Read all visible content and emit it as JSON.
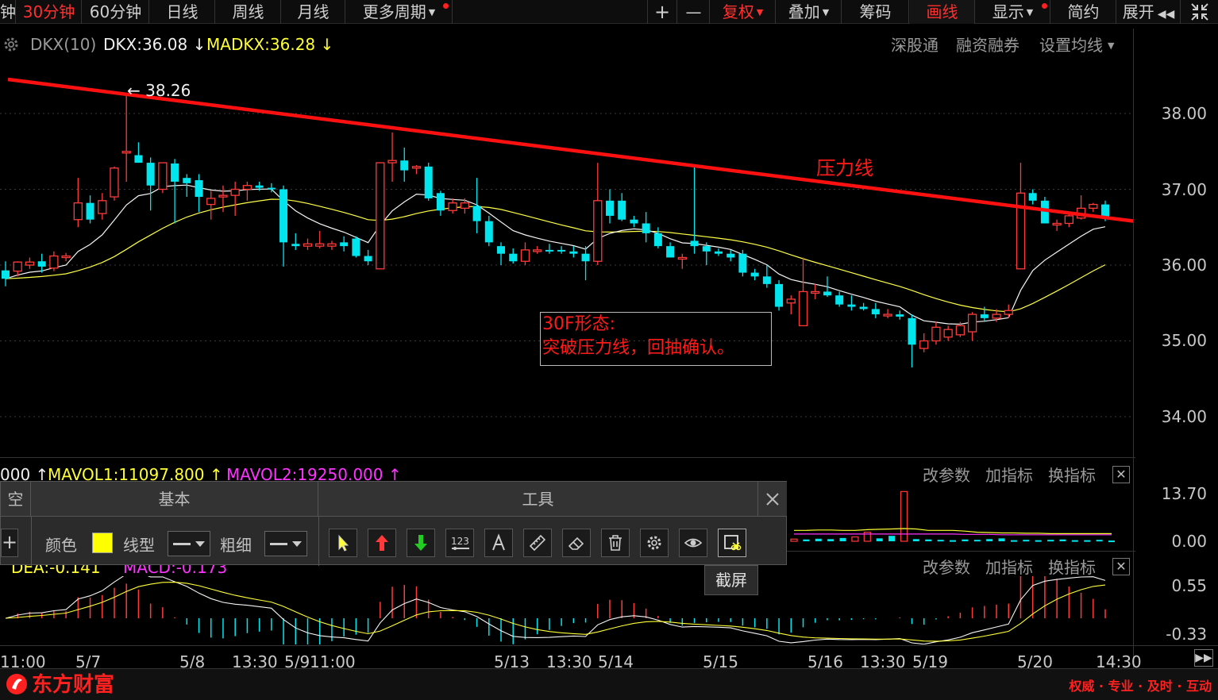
{
  "toolbar": {
    "tabs": [
      {
        "label": "钟",
        "active": false
      },
      {
        "label": "30分钟",
        "active": true
      },
      {
        "label": "60分钟",
        "active": false
      },
      {
        "label": "日线",
        "active": false
      },
      {
        "label": "周线",
        "active": false
      },
      {
        "label": "月线",
        "active": false
      },
      {
        "label": "更多周期",
        "active": false
      }
    ],
    "right": {
      "zoom_in": "+",
      "zoom_out": "—",
      "fuquan": "复权",
      "diejia": "叠加",
      "chouma": "筹码",
      "huaxian": "画线",
      "xianshi": "显示",
      "jianyue": "简约",
      "zhankai": "展开"
    }
  },
  "main_indicator": {
    "name": "DKX(10)",
    "dkx": "DKX:36.08",
    "madkx": "MADKX:36.28",
    "links": [
      "深股通",
      "融资融券",
      "设置均线"
    ]
  },
  "price_axis": [
    "38.00",
    "37.00",
    "36.00",
    "35.00",
    "34.00"
  ],
  "high_marker": "38.26",
  "pressure_line_label": "压力线",
  "annotation": {
    "line1": "30F形态:",
    "line2": "突破压力线，回抽确认。"
  },
  "volume_panel": {
    "vol_partial": "000",
    "mavol1": "MAVOL1:11097.800",
    "mavol2": "MAVOL2:19250.000",
    "links": [
      "改参数",
      "加指标",
      "换指标"
    ],
    "axis": [
      "13.70",
      "0.00"
    ]
  },
  "macd_panel": {
    "dea": "DEA:-0.141",
    "macd": "MACD:-0.173",
    "links": [
      "改参数",
      "加指标",
      "换指标"
    ],
    "axis": [
      "0.55",
      "-0.33"
    ]
  },
  "x_axis": [
    "11:00",
    "5/7",
    "5/8",
    "13:30",
    "5/9",
    "11:00",
    "5/13",
    "13:30",
    "5/14",
    "5/15",
    "5/16",
    "13:30",
    "5/19",
    "5/20",
    "14:30"
  ],
  "tool_panel": {
    "section_left_partial": "空",
    "section_basic": "基本",
    "section_tools": "工具",
    "color_label": "颜色",
    "line_type_label": "线型",
    "thickness_label": "粗细",
    "color_value": "#ffff00",
    "tooltip": "截屏"
  },
  "footer": {
    "logo": "东方财富",
    "slogan": "权威 · 专业 · 及时 · 互动"
  },
  "colors": {
    "up": "#ff3a3a",
    "down": "#00e5ee",
    "pressure_line": "#ff1010",
    "dkx_line": "#f5f5f5",
    "madkx_line": "#ffff44"
  },
  "chart_data": {
    "type": "candlestick",
    "period": "30分钟",
    "ylim": [
      33.5,
      38.9
    ],
    "candles": [
      {
        "o": 35.93,
        "h": 36.05,
        "l": 35.72,
        "c": 35.82
      },
      {
        "o": 35.92,
        "h": 36.05,
        "l": 35.85,
        "c": 36.04
      },
      {
        "o": 36.0,
        "h": 36.1,
        "l": 35.95,
        "c": 36.04
      },
      {
        "o": 36.05,
        "h": 36.15,
        "l": 35.9,
        "c": 35.98
      },
      {
        "o": 35.96,
        "h": 36.18,
        "l": 35.92,
        "c": 36.12
      },
      {
        "o": 36.1,
        "h": 36.16,
        "l": 36.05,
        "c": 36.12
      },
      {
        "o": 36.6,
        "h": 37.15,
        "l": 36.5,
        "c": 36.82
      },
      {
        "o": 36.82,
        "h": 36.92,
        "l": 36.55,
        "c": 36.6
      },
      {
        "o": 36.68,
        "h": 36.95,
        "l": 36.6,
        "c": 36.85
      },
      {
        "o": 36.9,
        "h": 37.3,
        "l": 36.85,
        "c": 37.28
      },
      {
        "o": 37.5,
        "h": 38.26,
        "l": 37.1,
        "c": 37.5
      },
      {
        "o": 37.45,
        "h": 37.62,
        "l": 37.35,
        "c": 37.35
      },
      {
        "o": 37.35,
        "h": 37.42,
        "l": 36.72,
        "c": 37.05
      },
      {
        "o": 37.0,
        "h": 37.35,
        "l": 36.95,
        "c": 37.35
      },
      {
        "o": 37.34,
        "h": 37.4,
        "l": 36.55,
        "c": 37.1
      },
      {
        "o": 37.15,
        "h": 37.2,
        "l": 36.9,
        "c": 37.08
      },
      {
        "o": 37.12,
        "h": 37.2,
        "l": 36.7,
        "c": 36.9
      },
      {
        "o": 36.8,
        "h": 36.98,
        "l": 36.6,
        "c": 36.88
      },
      {
        "o": 36.9,
        "h": 37.05,
        "l": 36.7,
        "c": 36.92
      },
      {
        "o": 36.92,
        "h": 37.1,
        "l": 36.65,
        "c": 37.0
      },
      {
        "o": 37.0,
        "h": 37.1,
        "l": 36.85,
        "c": 37.05
      },
      {
        "o": 37.05,
        "h": 37.1,
        "l": 36.98,
        "c": 37.02
      },
      {
        "o": 37.02,
        "h": 37.08,
        "l": 36.96,
        "c": 37.01
      },
      {
        "o": 37.0,
        "h": 37.05,
        "l": 35.98,
        "c": 36.3
      },
      {
        "o": 36.28,
        "h": 36.42,
        "l": 36.2,
        "c": 36.25
      },
      {
        "o": 36.25,
        "h": 36.35,
        "l": 36.2,
        "c": 36.28
      },
      {
        "o": 36.25,
        "h": 36.45,
        "l": 36.22,
        "c": 36.28
      },
      {
        "o": 36.25,
        "h": 36.32,
        "l": 36.2,
        "c": 36.28
      },
      {
        "o": 36.3,
        "h": 36.38,
        "l": 36.18,
        "c": 36.25
      },
      {
        "o": 36.35,
        "h": 36.38,
        "l": 36.1,
        "c": 36.12
      },
      {
        "o": 36.12,
        "h": 36.2,
        "l": 36.0,
        "c": 36.05
      },
      {
        "o": 35.95,
        "h": 37.35,
        "l": 35.95,
        "c": 37.35
      },
      {
        "o": 37.35,
        "h": 37.75,
        "l": 37.1,
        "c": 37.38
      },
      {
        "o": 37.38,
        "h": 37.55,
        "l": 37.1,
        "c": 37.25
      },
      {
        "o": 37.28,
        "h": 37.32,
        "l": 37.2,
        "c": 37.3
      },
      {
        "o": 37.3,
        "h": 37.35,
        "l": 36.85,
        "c": 36.88
      },
      {
        "o": 36.95,
        "h": 36.98,
        "l": 36.65,
        "c": 36.72
      },
      {
        "o": 36.72,
        "h": 36.88,
        "l": 36.68,
        "c": 36.82
      },
      {
        "o": 36.75,
        "h": 36.88,
        "l": 36.68,
        "c": 36.82
      },
      {
        "o": 36.78,
        "h": 37.15,
        "l": 36.42,
        "c": 36.58
      },
      {
        "o": 36.58,
        "h": 36.65,
        "l": 36.25,
        "c": 36.3
      },
      {
        "o": 36.25,
        "h": 36.3,
        "l": 36.0,
        "c": 36.15
      },
      {
        "o": 36.15,
        "h": 36.22,
        "l": 36.02,
        "c": 36.05
      },
      {
        "o": 36.05,
        "h": 36.3,
        "l": 36.0,
        "c": 36.2
      },
      {
        "o": 36.2,
        "h": 36.25,
        "l": 36.15,
        "c": 36.2
      },
      {
        "o": 36.2,
        "h": 36.28,
        "l": 36.15,
        "c": 36.18
      },
      {
        "o": 36.2,
        "h": 36.25,
        "l": 36.15,
        "c": 36.18
      },
      {
        "o": 36.18,
        "h": 36.25,
        "l": 36.1,
        "c": 36.15
      },
      {
        "o": 36.15,
        "h": 36.25,
        "l": 35.8,
        "c": 36.05
      },
      {
        "o": 36.05,
        "h": 37.35,
        "l": 36.0,
        "c": 36.85
      },
      {
        "o": 36.85,
        "h": 37.0,
        "l": 36.55,
        "c": 36.65
      },
      {
        "o": 36.85,
        "h": 36.95,
        "l": 36.58,
        "c": 36.6
      },
      {
        "o": 36.6,
        "h": 36.65,
        "l": 36.5,
        "c": 36.55
      },
      {
        "o": 36.55,
        "h": 36.7,
        "l": 36.3,
        "c": 36.42
      },
      {
        "o": 36.42,
        "h": 36.5,
        "l": 36.22,
        "c": 36.25
      },
      {
        "o": 36.25,
        "h": 36.3,
        "l": 36.1,
        "c": 36.1
      },
      {
        "o": 36.1,
        "h": 36.15,
        "l": 35.95,
        "c": 36.1
      },
      {
        "o": 36.32,
        "h": 37.3,
        "l": 36.15,
        "c": 36.25
      },
      {
        "o": 36.25,
        "h": 36.3,
        "l": 36.0,
        "c": 36.18
      },
      {
        "o": 36.18,
        "h": 36.22,
        "l": 36.12,
        "c": 36.15
      },
      {
        "o": 36.15,
        "h": 36.2,
        "l": 36.05,
        "c": 36.1
      },
      {
        "o": 36.15,
        "h": 36.2,
        "l": 35.85,
        "c": 35.9
      },
      {
        "o": 35.9,
        "h": 35.95,
        "l": 35.8,
        "c": 35.85
      },
      {
        "o": 35.85,
        "h": 36.0,
        "l": 35.7,
        "c": 35.75
      },
      {
        "o": 35.75,
        "h": 35.8,
        "l": 35.4,
        "c": 35.45
      },
      {
        "o": 35.5,
        "h": 35.6,
        "l": 35.35,
        "c": 35.55
      },
      {
        "o": 35.2,
        "h": 36.1,
        "l": 35.2,
        "c": 35.65
      },
      {
        "o": 35.65,
        "h": 35.75,
        "l": 35.55,
        "c": 35.65
      },
      {
        "o": 35.65,
        "h": 35.85,
        "l": 35.58,
        "c": 35.6
      },
      {
        "o": 35.6,
        "h": 35.65,
        "l": 35.45,
        "c": 35.48
      },
      {
        "o": 35.48,
        "h": 35.6,
        "l": 35.4,
        "c": 35.45
      },
      {
        "o": 35.45,
        "h": 35.5,
        "l": 35.4,
        "c": 35.42
      },
      {
        "o": 35.42,
        "h": 35.5,
        "l": 35.3,
        "c": 35.35
      },
      {
        "o": 35.35,
        "h": 35.42,
        "l": 35.3,
        "c": 35.35
      },
      {
        "o": 35.35,
        "h": 35.4,
        "l": 35.28,
        "c": 35.32
      },
      {
        "o": 35.3,
        "h": 35.35,
        "l": 34.65,
        "c": 34.95
      },
      {
        "o": 34.9,
        "h": 35.1,
        "l": 34.85,
        "c": 35.0
      },
      {
        "o": 35.0,
        "h": 35.25,
        "l": 34.95,
        "c": 35.18
      },
      {
        "o": 35.05,
        "h": 35.2,
        "l": 35.0,
        "c": 35.15
      },
      {
        "o": 35.08,
        "h": 35.25,
        "l": 35.05,
        "c": 35.2
      },
      {
        "o": 35.12,
        "h": 35.38,
        "l": 35.0,
        "c": 35.35
      },
      {
        "o": 35.35,
        "h": 35.45,
        "l": 35.25,
        "c": 35.3
      },
      {
        "o": 35.3,
        "h": 35.42,
        "l": 35.25,
        "c": 35.35
      },
      {
        "o": 35.35,
        "h": 35.48,
        "l": 35.3,
        "c": 35.4
      },
      {
        "o": 35.95,
        "h": 37.35,
        "l": 35.95,
        "c": 36.95
      },
      {
        "o": 36.95,
        "h": 37.0,
        "l": 36.8,
        "c": 36.85
      },
      {
        "o": 36.85,
        "h": 36.9,
        "l": 36.55,
        "c": 36.55
      },
      {
        "o": 36.55,
        "h": 36.6,
        "l": 36.45,
        "c": 36.55
      },
      {
        "o": 36.55,
        "h": 36.68,
        "l": 36.5,
        "c": 36.65
      },
      {
        "o": 36.62,
        "h": 36.92,
        "l": 36.6,
        "c": 36.75
      },
      {
        "o": 36.75,
        "h": 36.82,
        "l": 36.7,
        "c": 36.8
      },
      {
        "o": 36.8,
        "h": 36.85,
        "l": 36.58,
        "c": 36.62
      }
    ],
    "pressure_line": {
      "start": 38.45,
      "end": 36.58
    },
    "volume": {
      "ylim": [
        -0.5,
        14
      ],
      "values": [
        0.6,
        0.5,
        0.7,
        0.6,
        0.9,
        1.2,
        2.5,
        0.8,
        1.5,
        13.7,
        0.6,
        0.5,
        0.4,
        0.3,
        0.5,
        0.4,
        0.6,
        0.8,
        0.3,
        0.4,
        0.3,
        0.4,
        0.5,
        0.3,
        0.3,
        0.4,
        0.2
      ],
      "mavol1": [
        3.0,
        3.0,
        3.1,
        3.1,
        3.0,
        3.0,
        3.2,
        3.3,
        3.4,
        3.5,
        3.4,
        3.0,
        3.0,
        3.0,
        2.8,
        2.5,
        2.4,
        2.3,
        2.3,
        2.2,
        2.2,
        2.1,
        2.1,
        2.1,
        2.1,
        2.1,
        2.1
      ],
      "mavol2": [
        2.0,
        2.0,
        2.0,
        2.0,
        2.0,
        2.0,
        2.0,
        2.0,
        2.0,
        2.0,
        2.0,
        2.0,
        2.0,
        2.0,
        1.9,
        1.9,
        1.9,
        1.8,
        1.8,
        1.8,
        1.8,
        1.8,
        1.8,
        1.8,
        1.8,
        1.8,
        1.8
      ]
    }
  }
}
